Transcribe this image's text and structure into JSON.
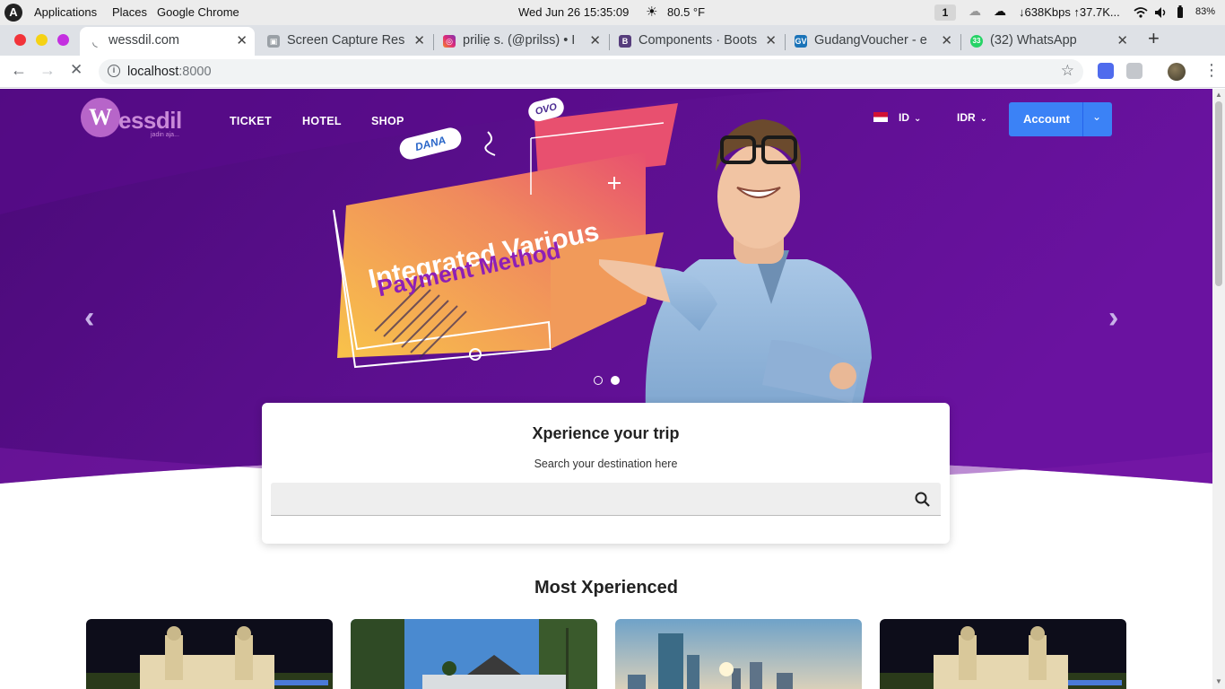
{
  "os_bar": {
    "activities": "Applications",
    "places": "Places",
    "app": "Google Chrome",
    "datetime": "Wed Jun 26  15:35:09",
    "weather": "80.5 °F",
    "workspace": "1",
    "network": "↓638Kbps ↑37.7K...",
    "battery": "83%"
  },
  "tabs": [
    {
      "title": "wessdil.com",
      "icon": "loading-spinner-icon",
      "active": true
    },
    {
      "title": "Screen Capture Res",
      "icon": "camera-icon"
    },
    {
      "title": "priliẹ s. (@prilss) • I",
      "icon": "instagram-icon"
    },
    {
      "title": "Components · Boots",
      "icon": "bootstrap-icon"
    },
    {
      "title": "GudangVoucher - e",
      "icon": "gv-icon"
    },
    {
      "title": "(32) WhatsApp",
      "icon": "whatsapp-icon"
    }
  ],
  "address_bar": {
    "host": "localhost",
    "port": ":8000"
  },
  "site": {
    "logo_text": "essdil",
    "logo_letter": "W",
    "logo_tagline": "jadin aja...",
    "nav": [
      "TICKET",
      "HOTEL",
      "SHOP"
    ],
    "language": "ID",
    "currency": "IDR",
    "account_label": "Account",
    "hero": {
      "line1": "Integrated Various",
      "line2": "Payment Method",
      "badge_dana": "DANA",
      "badge_ovo": "OVO",
      "slides": 2,
      "active_slide": 2
    },
    "search": {
      "title": "Xperience your trip",
      "subtitle": "Search your destination here",
      "placeholder": ""
    },
    "section_title": "Most Xperienced"
  },
  "colors": {
    "hero_purple": "#5a0e8a",
    "accent_blue": "#3b82f6",
    "banner_orange": "#f0a24e"
  }
}
